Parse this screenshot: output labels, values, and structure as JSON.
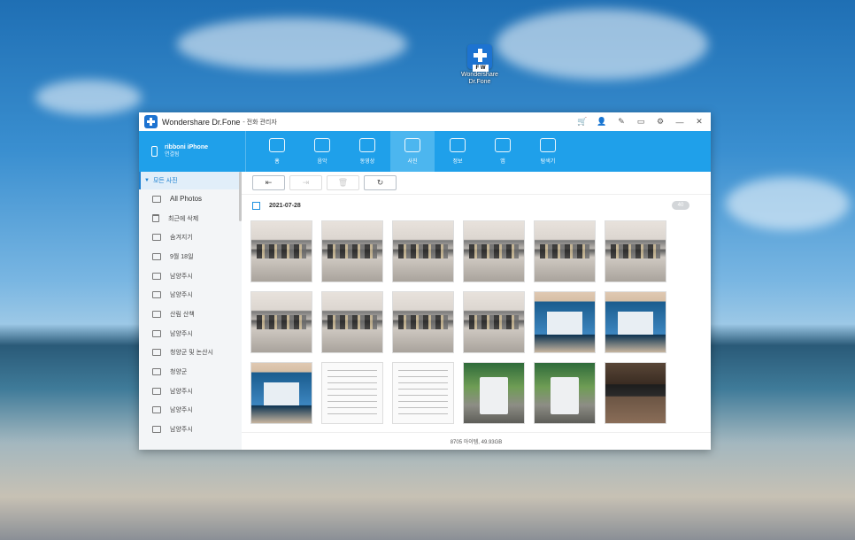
{
  "desktop": {
    "shortcut": {
      "label": "Wondershare Dr.Fone",
      "icon": "drfone-app-icon"
    }
  },
  "window": {
    "title": "Wondershare Dr.Fone",
    "subtitle": "- 전화 관리자",
    "controls": [
      "cart-icon",
      "user-icon",
      "feedback-icon",
      "message-icon",
      "settings-icon",
      "minimize-icon",
      "close-icon"
    ]
  },
  "device": {
    "name": "ribboni iPhone",
    "status": "연결됨"
  },
  "nav": {
    "tabs": [
      {
        "label": "홈",
        "icon": "home-icon"
      },
      {
        "label": "음악",
        "icon": "music-icon"
      },
      {
        "label": "동영상",
        "icon": "video-icon"
      },
      {
        "label": "사진",
        "icon": "photo-icon",
        "active": true
      },
      {
        "label": "정보",
        "icon": "contact-icon"
      },
      {
        "label": "앱",
        "icon": "apps-icon"
      },
      {
        "label": "탐색기",
        "icon": "explorer-icon"
      }
    ]
  },
  "sidebar": {
    "header": "모든 사진",
    "items": [
      {
        "label": "All Photos",
        "icon": "camera-icon"
      },
      {
        "label": "최근에 삭제",
        "icon": "trash-icon"
      },
      {
        "label": "숨겨지기",
        "icon": "album-icon"
      },
      {
        "label": "9월 18일",
        "icon": "album-icon"
      },
      {
        "label": "남양주시",
        "icon": "album-icon"
      },
      {
        "label": "남양주시",
        "icon": "album-icon"
      },
      {
        "label": "산림 산책",
        "icon": "album-icon"
      },
      {
        "label": "남양주시",
        "icon": "album-icon"
      },
      {
        "label": "청양군 및 논산시",
        "icon": "album-icon"
      },
      {
        "label": "청양군",
        "icon": "album-icon"
      },
      {
        "label": "남양주시",
        "icon": "album-icon"
      },
      {
        "label": "남양주시",
        "icon": "album-icon"
      },
      {
        "label": "남양주시",
        "icon": "album-icon"
      }
    ]
  },
  "actions": {
    "buttons": [
      {
        "glyph": "⇤",
        "name": "import-button",
        "enabled": true
      },
      {
        "glyph": "⇥",
        "name": "export-button",
        "enabled": false
      },
      {
        "glyph": "🗑",
        "name": "delete-button",
        "enabled": false
      },
      {
        "glyph": "↻",
        "name": "refresh-button",
        "enabled": true
      }
    ]
  },
  "gallery": {
    "date": "2021-07-28",
    "count": "40",
    "thumbnails": [
      "screen",
      "screen",
      "screen",
      "screen",
      "screen",
      "screen",
      "screen",
      "screen",
      "screen",
      "screen",
      "laptop",
      "laptop",
      "laptop",
      "doc",
      "doc",
      "box",
      "box",
      "device"
    ]
  },
  "footer": {
    "summary": "8705 아이템, 49.93GB"
  }
}
